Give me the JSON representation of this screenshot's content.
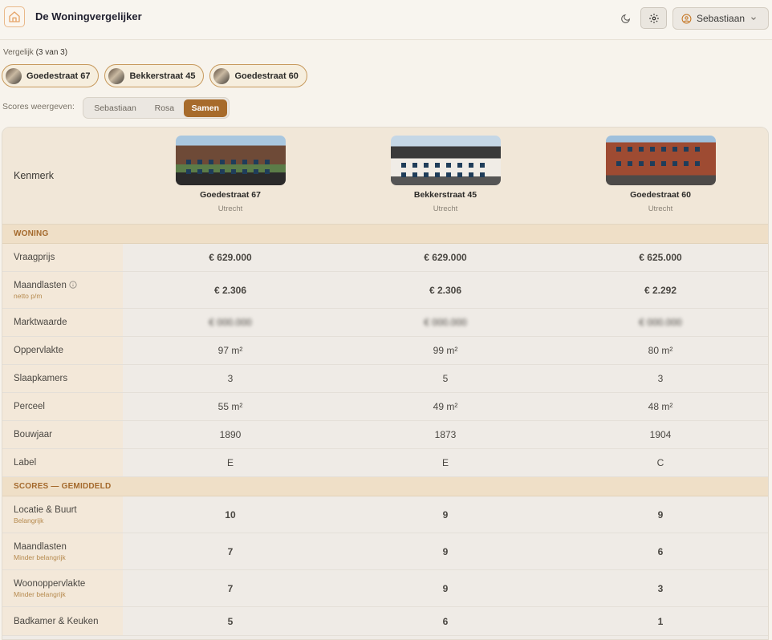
{
  "app": {
    "title": "De Woningvergelijker",
    "user": "Sebastiaan"
  },
  "compare": {
    "label_prefix": "Vergelijk",
    "count_label": "(3 van 3)",
    "chips": [
      "Goedestraat 67",
      "Bekkerstraat 45",
      "Goedestraat 60"
    ]
  },
  "scores_view": {
    "label": "Scores weergeven:",
    "options": [
      "Sebastiaan",
      "Rosa",
      "Samen"
    ],
    "selected": "Samen"
  },
  "table": {
    "corner_label": "Kenmerk",
    "houses": [
      {
        "name": "Goedestraat 67",
        "city": "Utrecht"
      },
      {
        "name": "Bekkerstraat 45",
        "city": "Utrecht"
      },
      {
        "name": "Goedestraat 60",
        "city": "Utrecht"
      }
    ],
    "sections": [
      {
        "title": "WONING",
        "rows": [
          {
            "label": "Vraagprijs",
            "values": [
              "€ 629.000",
              "€ 629.000",
              "€ 625.000"
            ]
          },
          {
            "label": "Maandlasten",
            "sub": "netto p/m",
            "values": [
              "€ 2.306",
              "€ 2.306",
              "€ 2.292"
            ]
          },
          {
            "label": "Marktwaarde",
            "values": [
              "€ 000.000",
              "€ 000.000",
              "€ 000.000"
            ]
          },
          {
            "label": "Oppervlakte",
            "values": [
              "97 m²",
              "99 m²",
              "80 m²"
            ]
          },
          {
            "label": "Slaapkamers",
            "values": [
              "3",
              "5",
              "3"
            ]
          },
          {
            "label": "Perceel",
            "values": [
              "55 m²",
              "49 m²",
              "48 m²"
            ]
          },
          {
            "label": "Bouwjaar",
            "values": [
              "1890",
              "1873",
              "1904"
            ]
          },
          {
            "label": "Label",
            "values": [
              "E",
              "E",
              "C"
            ]
          }
        ]
      },
      {
        "title": "SCORES — GEMIDDELD",
        "rows": [
          {
            "label": "Locatie & Buurt",
            "sub": "Belangrijk",
            "values": [
              "10",
              "9",
              "9"
            ],
            "colors": [
              "#3a9a5b",
              "#3a9a5b",
              "#3a9a5b"
            ]
          },
          {
            "label": "Maandlasten",
            "sub": "Minder belangrijk",
            "values": [
              "7",
              "9",
              "6"
            ],
            "colors": [
              "#3a9a5b",
              "#3a9a5b",
              "#d09531"
            ]
          },
          {
            "label": "Woonoppervlakte",
            "sub": "Minder belangrijk",
            "values": [
              "7",
              "9",
              "3"
            ],
            "colors": [
              "#3a9a5b",
              "#3a9a5b",
              "#e25b50"
            ]
          },
          {
            "label": "Badkamer & Keuken",
            "values": [
              "5",
              "6",
              "1"
            ],
            "colors": [
              "#d09531",
              "#d09531",
              "#e25b50"
            ]
          }
        ]
      }
    ]
  },
  "colors": {
    "accent": "#a76b2b",
    "price": "#b8803c",
    "score_good": "#3a9a5b",
    "score_mid": "#d09531",
    "score_bad": "#e25b50"
  }
}
